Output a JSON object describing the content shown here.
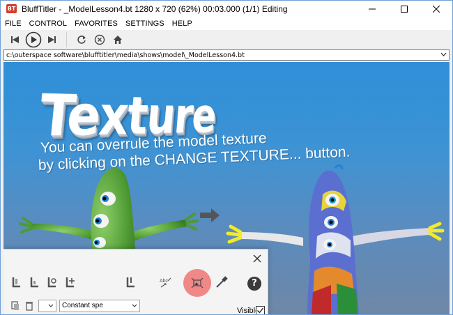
{
  "window": {
    "app_icon_text": "BT",
    "title": "BluffTitler - _ModelLesson4.bt 1280 x 720 (62%) 00:03.000 (1/1) Editing"
  },
  "menu": [
    "FILE",
    "CONTROL",
    "FAVORITES",
    "SETTINGS",
    "HELP"
  ],
  "path": "c:\\outerspace software\\blufftitler\\media\\shows\\model\\_ModelLesson4.bt",
  "scene": {
    "title": "Texture",
    "line1": "You can overrule the model texture",
    "line2": "by clicking on the CHANGE TEXTURE... button."
  },
  "panel": {
    "select_left_value": "",
    "select_style_value": "Constant spe",
    "visible_label": "Visible",
    "help_label": "?"
  },
  "colors": {
    "accent": "#d93a2a",
    "highlight": "#f05a5a",
    "sky_top": "#2e8fd8",
    "sky_bottom": "#6f87a6"
  }
}
